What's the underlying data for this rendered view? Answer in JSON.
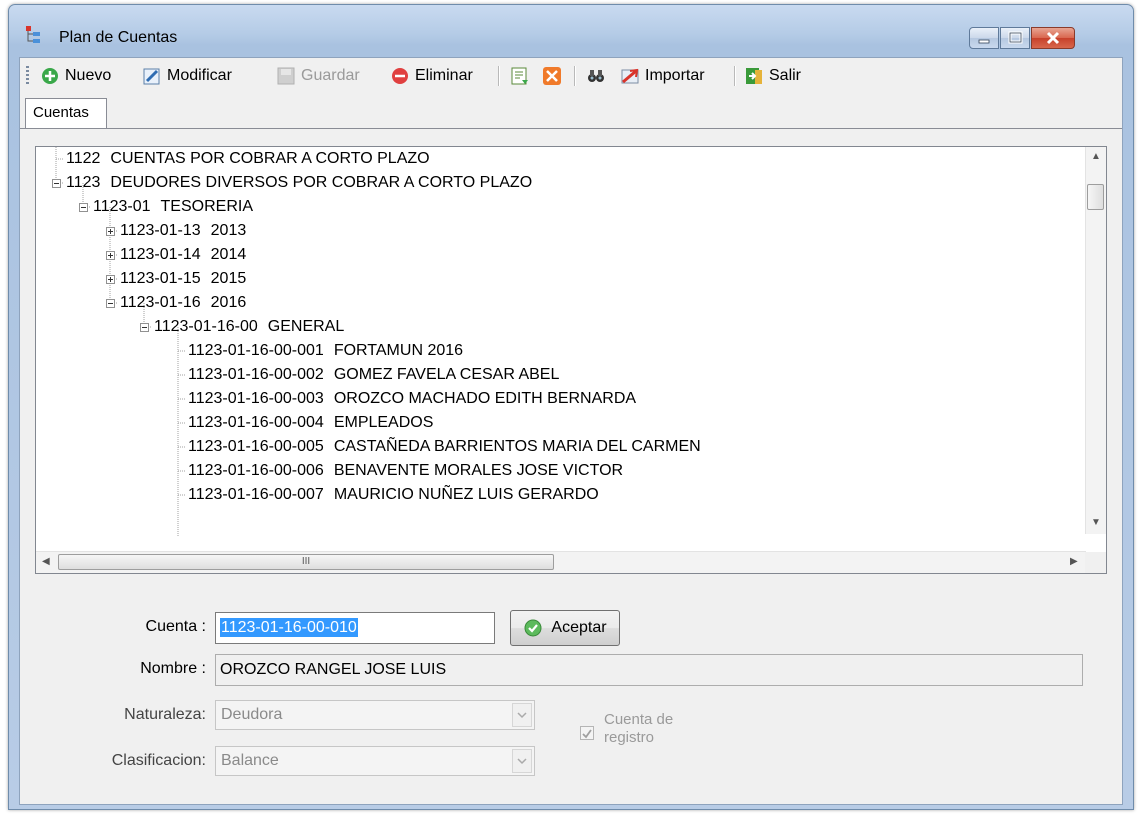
{
  "window": {
    "title": "Plan de Cuentas",
    "icon": "tree-chart-icon",
    "controls": [
      "minimize",
      "maximize",
      "close"
    ]
  },
  "toolbar": {
    "nuevo": "Nuevo",
    "modificar": "Modificar",
    "guardar": "Guardar",
    "eliminar": "Eliminar",
    "importar": "Importar",
    "salir": "Salir"
  },
  "tabs": {
    "cuentas": "Cuentas"
  },
  "tree": {
    "nodes": [
      {
        "code": "1122",
        "name": "CUENTAS POR COBRAR A CORTO PLAZO"
      },
      {
        "code": "1123",
        "name": "DEUDORES DIVERSOS POR COBRAR A CORTO PLAZO",
        "expanded": true
      },
      {
        "code": "1123-01",
        "name": "TESORERIA",
        "expanded": true
      },
      {
        "code": "1123-01-13",
        "name": "2013",
        "expanded": false
      },
      {
        "code": "1123-01-14",
        "name": "2014",
        "expanded": false
      },
      {
        "code": "1123-01-15",
        "name": "2015",
        "expanded": false
      },
      {
        "code": "1123-01-16",
        "name": "2016",
        "expanded": true
      },
      {
        "code": "1123-01-16-00",
        "name": "GENERAL",
        "expanded": true
      },
      {
        "code": "1123-01-16-00-001",
        "name": "FORTAMUN 2016"
      },
      {
        "code": "1123-01-16-00-002",
        "name": "GOMEZ FAVELA CESAR ABEL"
      },
      {
        "code": "1123-01-16-00-003",
        "name": "OROZCO MACHADO EDITH BERNARDA"
      },
      {
        "code": "1123-01-16-00-004",
        "name": "EMPLEADOS"
      },
      {
        "code": "1123-01-16-00-005",
        "name": "CASTAÑEDA BARRIENTOS MARIA DEL CARMEN"
      },
      {
        "code": "1123-01-16-00-006",
        "name": "BENAVENTE MORALES JOSE VICTOR"
      },
      {
        "code": "1123-01-16-00-007",
        "name": "MAURICIO NUÑEZ LUIS GERARDO"
      }
    ],
    "hscroll_grip": "III"
  },
  "form": {
    "cuenta_label": "Cuenta :",
    "cuenta_value": "1123-01-16-00-010",
    "aceptar": "Aceptar",
    "nombre_label": "Nombre :",
    "nombre_value": "OROZCO RANGEL JOSE LUIS",
    "naturaleza_label": "Naturaleza:",
    "naturaleza_value": "Deudora",
    "clasificacion_label": "Clasificacion:",
    "clasificacion_value": "Balance",
    "registro_line1": "Cuenta de",
    "registro_line2": "registro",
    "registro_checked": true
  }
}
